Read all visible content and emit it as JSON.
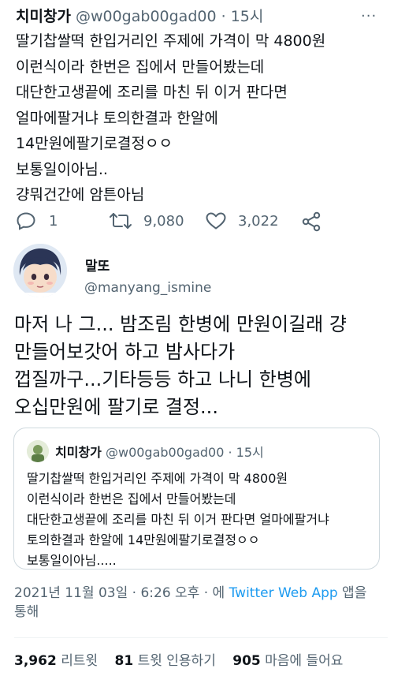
{
  "tweet1": {
    "display_name": "치미창가",
    "handle": "@w00gab00gad00",
    "separator": "·",
    "time": "15시",
    "more": "···",
    "lines": [
      "딸기찹쌀떡 한입거리인 주제에 가격이 막 4800원",
      "이런식이라 한번은 집에서 만들어봤는데",
      "대단한고생끝에 조리를 마친 뒤 이거 판다면",
      "얼마에팔거냐 토의한결과 한알에",
      "14만원에팔기로결정ㅇㅇ",
      "보통일이아님..",
      "걍뭐건간에 암튼아님"
    ],
    "actions": {
      "reply_count": "1",
      "retweet_count": "9,080",
      "like_count": "3,022"
    }
  },
  "tweet2": {
    "display_name": "말또",
    "handle": "@manyang_ismine",
    "lines": [
      "마저 나 그... 밤조림 한병에 만원이길래 걍",
      "만들어보갓어 하고 밤사다가",
      "껍질까구...기타등등 하고 나니 한병에",
      "오십만원에 팔기로 결정..."
    ]
  },
  "quote": {
    "display_name": "치미창가",
    "handle": "@w00gab00gad00",
    "separator": "·",
    "time": "15시",
    "lines": [
      "딸기찹쌀떡 한입거리인 주제에 가격이 막 4800원",
      "이런식이라 한번은 집에서 만들어봤는데",
      "대단한고생끝에 조리를 마친 뒤 이거 판다면 얼마에팔거냐",
      "토의한결과 한알에 14만원에팔기로결정ㅇㅇ",
      "보통일이아님....."
    ]
  },
  "meta": {
    "timestamp": "2021년 11월 03일 · 6:26 오후 · 에 ",
    "app": "Twitter Web App",
    "suffix": " 앱을",
    "line2": "통해"
  },
  "stats": {
    "retweets": "3,962",
    "retweets_label": "리트윗",
    "quotes": "81",
    "quotes_label": "트윗 인용하기",
    "likes": "905",
    "likes_label": "마음에 들어요"
  },
  "icons": {
    "reply": "reply-icon",
    "retweet": "retweet-icon",
    "like": "heart-icon",
    "share": "share-icon"
  },
  "colors": {
    "text": "#0f1419",
    "secondary": "#536471",
    "link": "#1d9bf0",
    "border": "#cfd9de"
  }
}
